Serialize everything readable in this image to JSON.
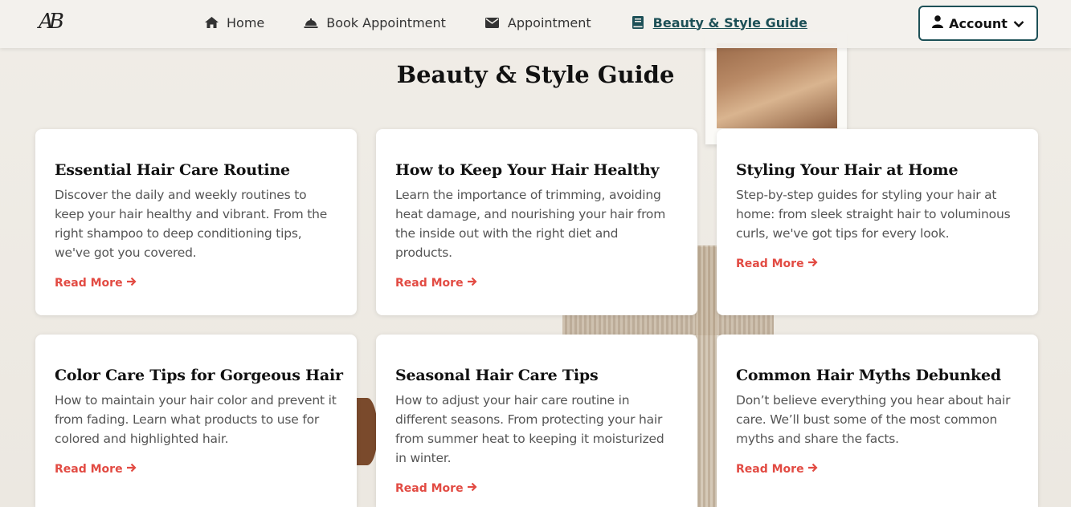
{
  "logo": {
    "text": "AB"
  },
  "nav": {
    "items": [
      {
        "label": "Home",
        "icon": "home-icon"
      },
      {
        "label": "Book Appointment",
        "icon": "service-bell-icon"
      },
      {
        "label": "Appointment",
        "icon": "envelope-icon"
      },
      {
        "label": "Beauty & Style Guide",
        "icon": "book-icon",
        "active": true
      }
    ],
    "account_label": "Account"
  },
  "page": {
    "title": "Beauty & Style Guide"
  },
  "cards": [
    {
      "title": "Essential Hair Care Routine",
      "text": "Discover the daily and weekly routines to keep your hair healthy and vibrant. From the right shampoo to deep conditioning tips, we've got you covered.",
      "link": "Read More"
    },
    {
      "title": "How to Keep Your Hair Healthy",
      "text": "Learn the importance of trimming, avoiding heat damage, and nourishing your hair from the inside out with the right diet and products.",
      "link": "Read More"
    },
    {
      "title": "Styling Your Hair at Home",
      "text": "Step-by-step guides for styling your hair at home: from sleek straight hair to voluminous curls, we've got tips for every look.",
      "link": "Read More"
    },
    {
      "title": "Color Care Tips for Gorgeous Hair",
      "text": "How to maintain your hair color and prevent it from fading. Learn what products to use for colored and highlighted hair.",
      "link": "Read More"
    },
    {
      "title": "Seasonal Hair Care Tips",
      "text": "How to adjust your hair care routine in different seasons. From protecting your hair from summer heat to keeping it moisturized in winter.",
      "link": "Read More"
    },
    {
      "title": "Common Hair Myths Debunked",
      "text": "Don’t believe everything you hear about hair care. We’ll bust some of the most common myths and share the facts.",
      "link": "Read More"
    }
  ],
  "colors": {
    "accent": "#1d5057",
    "link": "#e24b43"
  }
}
